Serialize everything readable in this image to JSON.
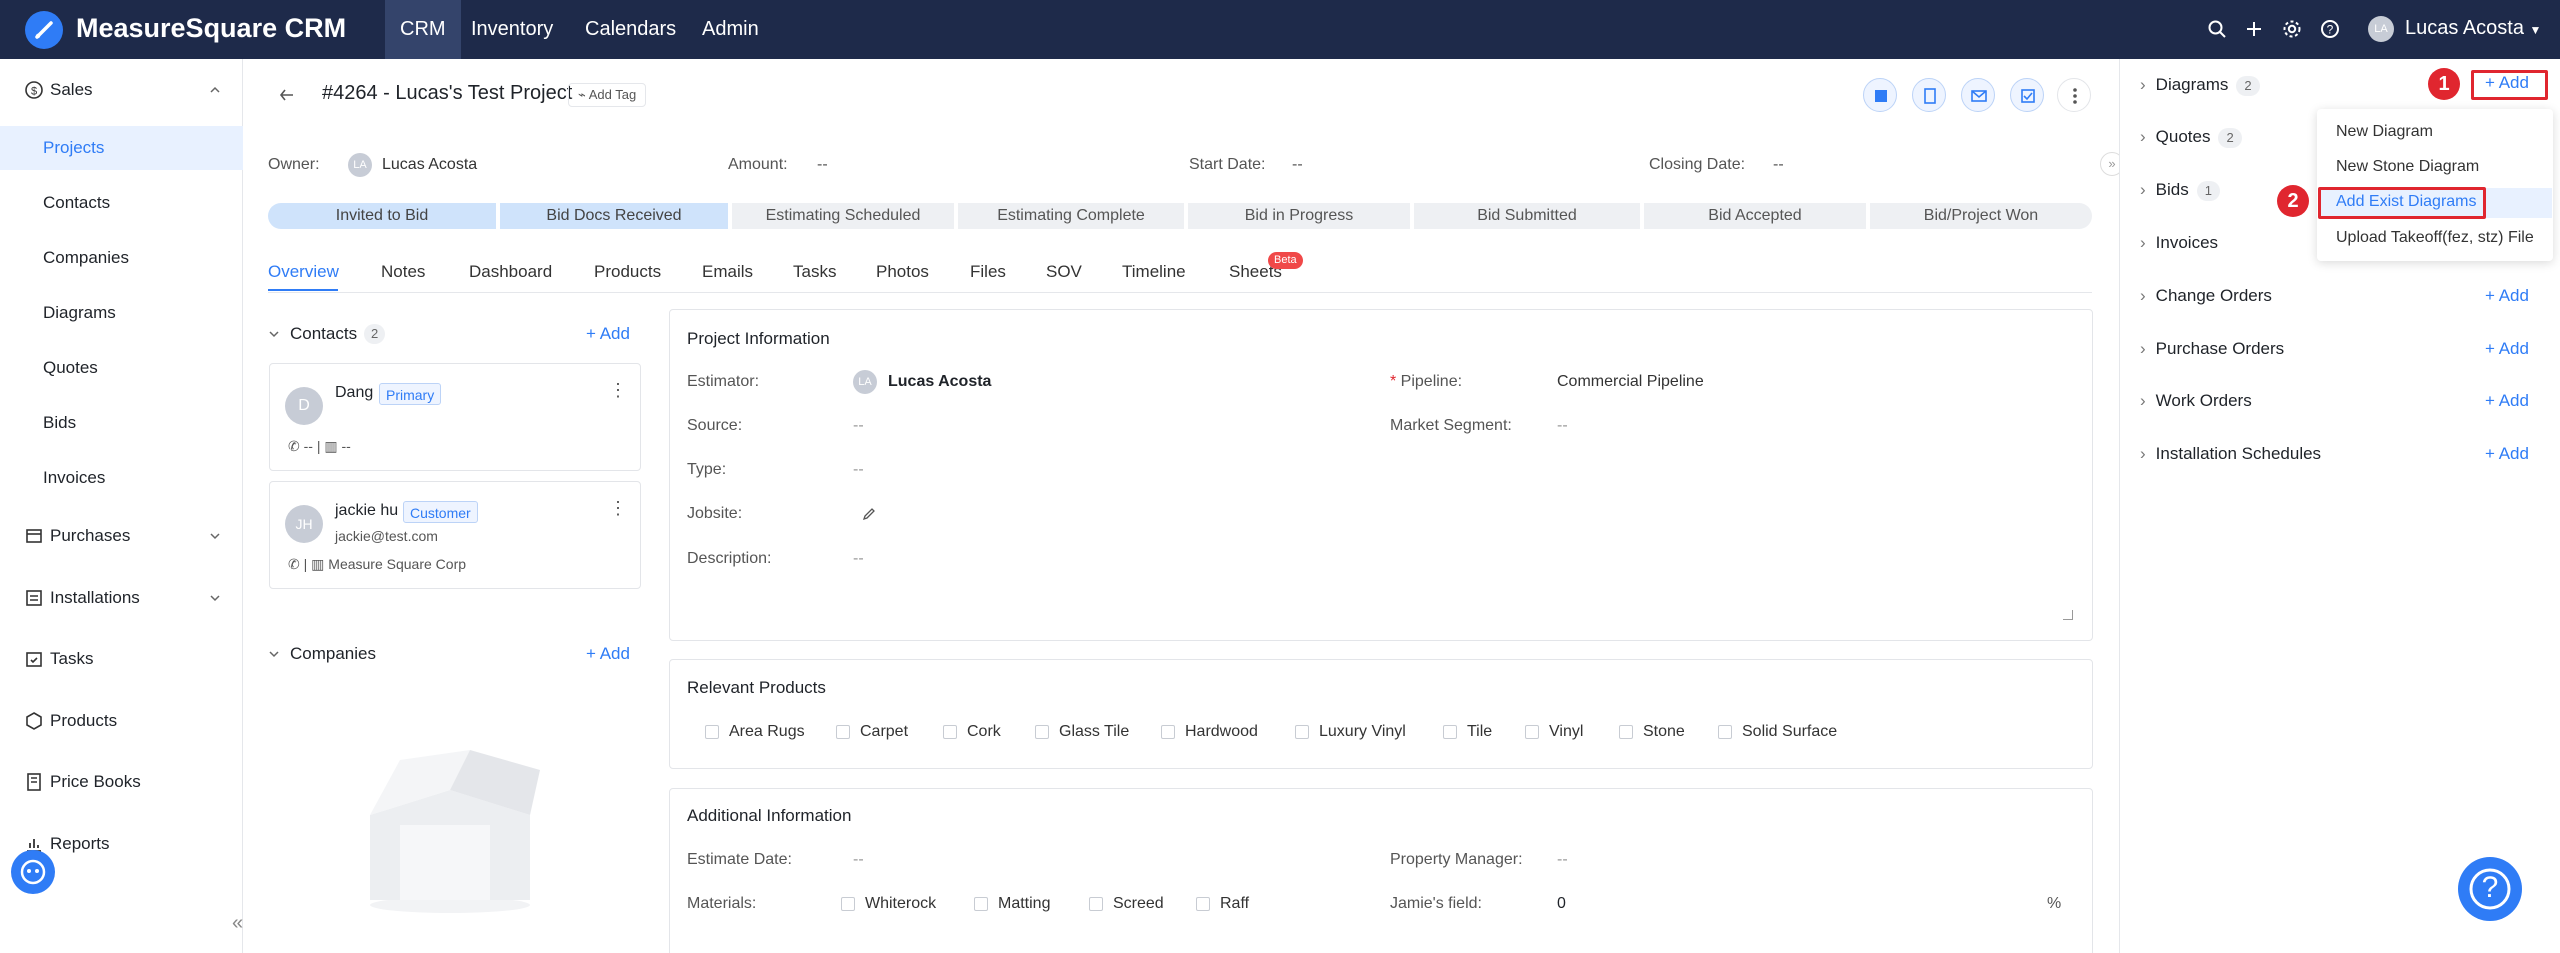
{
  "app": {
    "title": "MeasureSquare CRM"
  },
  "nav": [
    "CRM",
    "Inventory",
    "Calendars",
    "Admin"
  ],
  "user": {
    "initials": "LA",
    "name": "Lucas Acosta"
  },
  "sidebar": {
    "sales": "Sales",
    "sales_items": [
      "Projects",
      "Contacts",
      "Companies",
      "Diagrams",
      "Quotes",
      "Bids",
      "Invoices"
    ],
    "purchases": "Purchases",
    "installations": "Installations",
    "tasks": "Tasks",
    "products": "Products",
    "price_books": "Price Books",
    "reports": "Reports",
    "collapse": "«"
  },
  "project": {
    "title": "#4264 - Lucas's Test Project",
    "add_tag": "Add Tag",
    "owner_label": "Owner:",
    "owner": "Lucas Acosta",
    "owner_initials": "LA",
    "amount_label": "Amount:",
    "amount": "--",
    "start_label": "Start Date:",
    "start": "--",
    "closing_label": "Closing Date:",
    "closing": "--"
  },
  "stages": [
    "Invited to Bid",
    "Bid Docs Received",
    "Estimating Scheduled",
    "Estimating Complete",
    "Bid in Progress",
    "Bid Submitted",
    "Bid Accepted",
    "Bid/Project Won"
  ],
  "tabs": [
    "Overview",
    "Notes",
    "Dashboard",
    "Products",
    "Emails",
    "Tasks",
    "Photos",
    "Files",
    "SOV",
    "Timeline",
    "Sheets"
  ],
  "tab_badge": "Beta",
  "contacts": {
    "title": "Contacts",
    "count": "2",
    "add": "Add",
    "items": [
      {
        "initials": "D",
        "name": "Dang",
        "tag": "Primary",
        "phone": "--",
        "company": "--",
        "email": ""
      },
      {
        "initials": "JH",
        "name": "jackie hu",
        "tag": "Customer",
        "email": "jackie@test.com",
        "company": "Measure Square Corp",
        "phone": ""
      }
    ]
  },
  "companies": {
    "title": "Companies",
    "add": "Add"
  },
  "project_info": {
    "title": "Project Information",
    "estimator_label": "Estimator:",
    "estimator": "Lucas Acosta",
    "estimator_initials": "LA",
    "pipeline_label": "Pipeline:",
    "pipeline": "Commercial Pipeline",
    "source_label": "Source:",
    "source": "--",
    "market_label": "Market Segment:",
    "market": "--",
    "type_label": "Type:",
    "type": "--",
    "jobsite_label": "Jobsite:",
    "description_label": "Description:",
    "description": "--"
  },
  "relevant_products": {
    "title": "Relevant Products",
    "items": [
      "Area Rugs",
      "Carpet",
      "Cork",
      "Glass Tile",
      "Hardwood",
      "Luxury Vinyl",
      "Tile",
      "Vinyl",
      "Stone",
      "Solid Surface"
    ]
  },
  "additional_info": {
    "title": "Additional Information",
    "estimate_label": "Estimate Date:",
    "estimate": "--",
    "pm_label": "Property Manager:",
    "pm": "--",
    "materials_label": "Materials:",
    "materials": [
      "Whiterock",
      "Matting",
      "Screed",
      "Raff"
    ],
    "jamie_label": "Jamie's field:",
    "jamie": "0",
    "jamie_unit": "%"
  },
  "right_panel": {
    "rows": [
      {
        "label": "Diagrams",
        "count": "2",
        "add": "Add"
      },
      {
        "label": "Quotes",
        "count": "2",
        "add": ""
      },
      {
        "label": "Bids",
        "count": "1",
        "add": ""
      },
      {
        "label": "Invoices",
        "count": "",
        "add": ""
      },
      {
        "label": "Change Orders",
        "count": "",
        "add": "Add"
      },
      {
        "label": "Purchase Orders",
        "count": "",
        "add": "Add"
      },
      {
        "label": "Work Orders",
        "count": "",
        "add": "Add"
      },
      {
        "label": "Installation Schedules",
        "count": "",
        "add": "Add"
      }
    ]
  },
  "dropdown": [
    "New Diagram",
    "New Stone Diagram",
    "Add Exist Diagrams",
    "Upload Takeoff(fez, stz) File"
  ],
  "annotations": [
    "1",
    "2"
  ],
  "help": "?",
  "colors": {
    "topbar": "#1e2a4a",
    "accent": "#2f7cf6",
    "annotation": "#e0262f"
  }
}
